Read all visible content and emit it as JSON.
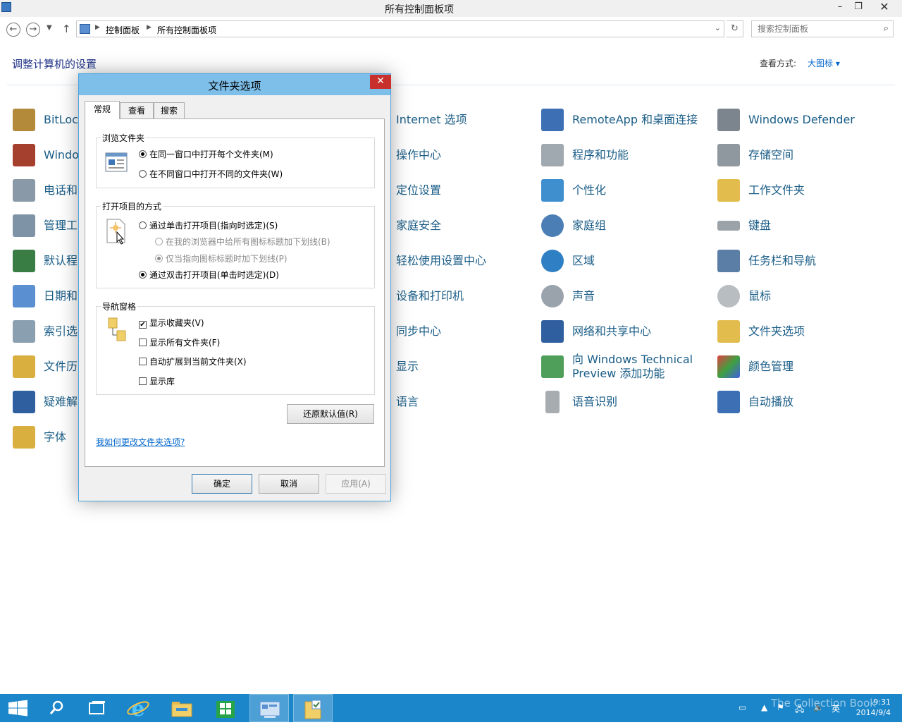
{
  "window": {
    "title": "所有控制面板项",
    "minimize": "–",
    "maximize": "❐",
    "close": "✕"
  },
  "nav": {
    "back": "←",
    "forward": "→",
    "up": "↑",
    "refresh": "↻",
    "breadcrumb": [
      "控制面板",
      "所有控制面板项"
    ],
    "search_placeholder": "搜索控制面板"
  },
  "header": {
    "title": "调整计算机的设置",
    "view_by_label": "查看方式:",
    "view_by_value": "大图标 ▾"
  },
  "items": {
    "col1": [
      "BitLocl",
      "Windo",
      "电话和",
      "管理工",
      "默认程",
      "日期和",
      "索引选",
      "文件历",
      "疑难解",
      "字体"
    ],
    "col2": [
      "Internet 选项",
      "操作中心",
      "定位设置",
      "家庭安全",
      "轻松使用设置中心",
      "设备和打印机",
      "同步中心",
      "显示",
      "语言"
    ],
    "col3": [
      "RemoteApp 和桌面连接",
      "程序和功能",
      "个性化",
      "家庭组",
      "区域",
      "声音",
      "网络和共享中心",
      "向 Windows Technical",
      "Preview 添加功能",
      "语音识别"
    ],
    "col4": [
      "Windows Defender",
      "存储空间",
      "工作文件夹",
      "键盘",
      "任务栏和导航",
      "鼠标",
      "文件夹选项",
      "颜色管理",
      "自动播放"
    ]
  },
  "dialog": {
    "title": "文件夹选项",
    "close": "✕",
    "tabs": [
      "常规",
      "查看",
      "搜索"
    ],
    "browse": {
      "title": "浏览文件夹",
      "opt1": "在同一窗口中打开每个文件夹(M)",
      "opt2": "在不同窗口中打开不同的文件夹(W)",
      "selected": 1
    },
    "open": {
      "title": "打开项目的方式",
      "opt1": "通过单击打开项目(指向时选定)(S)",
      "sub1": "在我的浏览器中给所有图标标题加下划线(B)",
      "sub2": "仅当指向图标标题时加下划线(P)",
      "opt2": "通过双击打开项目(单击时选定)(D)",
      "selected": 2
    },
    "nav": {
      "title": "导航窗格",
      "cb1": "显示收藏夹(V)",
      "cb2": "显示所有文件夹(F)",
      "cb3": "自动扩展到当前文件夹(X)",
      "cb4": "显示库",
      "checked": [
        true,
        false,
        false,
        false
      ]
    },
    "restore": "还原默认值(R)",
    "help_link": "我如何更改文件夹选项?",
    "ok": "确定",
    "cancel": "取消",
    "apply": "应用(A)"
  },
  "taskbar": {
    "ime": "英",
    "time": "9:31",
    "date": "2014/9/4",
    "watermark": "The Collection Book"
  },
  "colors": {
    "accent": "#1b86c9",
    "link": "#1a5d87",
    "dialog_title": "#7ebfea",
    "close_red": "#c7302b"
  }
}
